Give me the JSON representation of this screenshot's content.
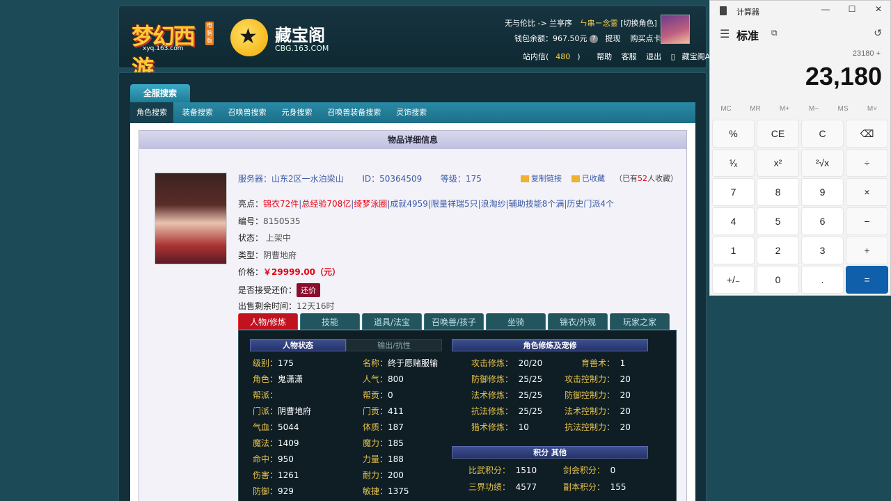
{
  "header": {
    "game_logo_text": "梦幻西游",
    "game_logo_sub": "xyq.163.com",
    "game_logo_badge": "电脑版",
    "site_name": "藏宝阁",
    "site_url": "CBG.163.COM",
    "user": {
      "server_route": "无与伦比 -> 兰亭序",
      "role_name": "ㄣ串ㄧ念霊",
      "switch_role": "[切换角色]",
      "wallet_label": "钱包余额：",
      "wallet_value": "967.50元",
      "withdraw": "提现",
      "buy_card": "购买点卡"
    },
    "links": {
      "inbox": "站内信(",
      "inbox_count": "480",
      "inbox_close": ")",
      "help": "帮助",
      "service": "客服",
      "logout": "退出",
      "app": "藏宝阁APP"
    }
  },
  "nav": {
    "main_tab": "全服搜索",
    "sub": [
      "角色搜索",
      "装备搜索",
      "召唤兽搜索",
      "元身搜索",
      "召唤兽装备搜索",
      "灵饰搜索"
    ]
  },
  "panel": {
    "title": "物品详细信息",
    "server_label": "服务器：",
    "server_value": "山东2区一水泊梁山",
    "id_label": "ID：",
    "id_value": "50364509",
    "level_label": "等级：",
    "level_value": "175",
    "copy_link": "复制链接",
    "collected": "已收藏",
    "collect_count_pre": "（已有",
    "collect_count": "52",
    "collect_count_post": "人收藏）",
    "highlights_label": "亮点：",
    "highlights": {
      "h1": "锦衣72件",
      "h2": "总经验708亿",
      "h3": "绮梦泳圈",
      "h4": "成就4959",
      "h5": "限量祥瑞5只",
      "h6": "浪淘纱",
      "h7": "辅助技能8个满",
      "h8": "历史门派4个"
    },
    "serial_label": "编号：",
    "serial_value": "8150535",
    "status_label": "状态：",
    "status_value": "上架中",
    "type_label": "类型：",
    "type_value": "阴曹地府",
    "price_label": "价格：",
    "price_value": "￥29999.00（元）",
    "haggle_label": "是否接受还价：",
    "haggle_button": "还价",
    "time_label": "出售剩余时间：",
    "time_value": "12天16时"
  },
  "detail_tabs": [
    "人物/修炼",
    "技能",
    "道具/法宝",
    "召唤兽/孩子",
    "坐骑",
    "锦衣/外观",
    "玩家之家"
  ],
  "detail": {
    "sec_status": "人物状态",
    "sec_output": "输出/抗性",
    "sec_cultivation": "角色修炼及宠修",
    "sec_points": "积分 其他",
    "left": {
      "level_k": "级别：",
      "level_v": "175",
      "role_k": "角色：",
      "role_v": "鬼潇潇",
      "gang_k": "帮派：",
      "gang_v": "",
      "school_k": "门派：",
      "school_v": "阴曹地府",
      "hp_k": "气血：",
      "hp_v": "5044",
      "mp_k": "魔法：",
      "mp_v": "1409",
      "hit_k": "命中：",
      "hit_v": "950",
      "dmg_k": "伤害：",
      "dmg_v": "1261",
      "def_k": "防御：",
      "def_v": "929"
    },
    "mid": {
      "name_k": "名称：",
      "name_v": "终于愿赌服输",
      "pop_k": "人气：",
      "pop_v": "800",
      "gangc_k": "帮贡：",
      "gangc_v": "0",
      "schoolc_k": "门贡：",
      "schoolc_v": "411",
      "con_k": "体质：",
      "con_v": "187",
      "mag_k": "魔力：",
      "mag_v": "185",
      "str_k": "力量：",
      "str_v": "188",
      "end_k": "耐力：",
      "end_v": "200",
      "agi_k": "敏捷：",
      "agi_v": "1375"
    },
    "cult": {
      "atk_k": "攻击修炼：",
      "atk_v": "20/20",
      "pdef_k": "防御修炼：",
      "pdef_v": "25/25",
      "matk_k": "法术修炼：",
      "matk_v": "25/25",
      "mres_k": "抗法修炼：",
      "mres_v": "25/25",
      "hunt_k": "猎术修炼：",
      "hunt_v": "10",
      "beast_k": "育兽术：",
      "beast_v": "1",
      "ac_k": "攻击控制力：",
      "ac_v": "20",
      "dc_k": "防御控制力：",
      "dc_v": "20",
      "mc_k": "法术控制力：",
      "mc_v": "20",
      "rc_k": "抗法控制力：",
      "rc_v": "20"
    },
    "points": {
      "pvp_k": "比武积分：",
      "pvp_v": "1510",
      "sword_k": "剑会积分：",
      "sword_v": "0",
      "merit_k": "三界功绩：",
      "merit_v": "4577",
      "dungeon_k": "副本积分：",
      "dungeon_v": "155"
    }
  },
  "calculator": {
    "title": "计算器",
    "mode": "标准",
    "expression": "23180 +",
    "display": "23,180",
    "memory": [
      "MC",
      "MR",
      "M+",
      "M−",
      "MS",
      "M˅"
    ],
    "keys": [
      [
        "%",
        "CE",
        "C",
        "⌫"
      ],
      [
        "¹⁄ₓ",
        "x²",
        "²√x",
        "÷"
      ],
      [
        "7",
        "8",
        "9",
        "×"
      ],
      [
        "4",
        "5",
        "6",
        "−"
      ],
      [
        "1",
        "2",
        "3",
        "+"
      ],
      [
        "+/₋",
        "0",
        ".",
        "="
      ]
    ]
  }
}
